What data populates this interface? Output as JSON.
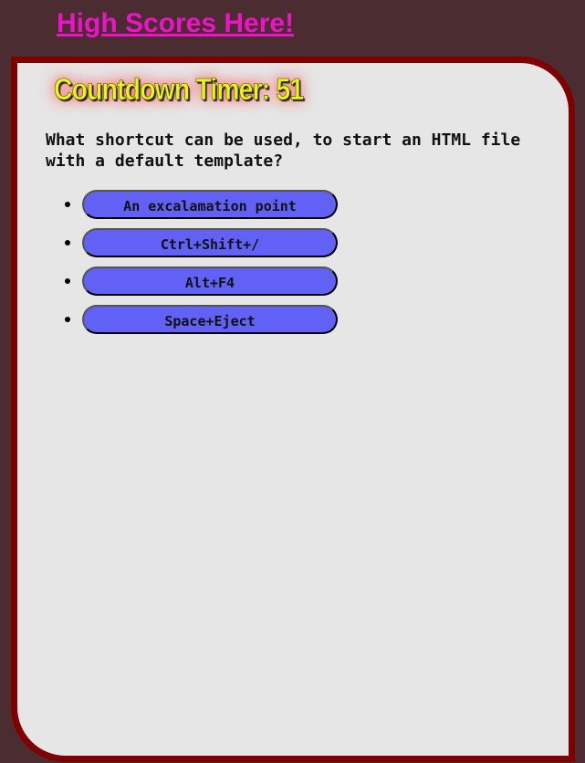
{
  "header": {
    "high_scores_link": "High Scores Here!"
  },
  "quiz": {
    "timer_text": "Countdown Timer: 51",
    "question": "What shortcut can be used, to start an HTML file with a default template?",
    "answers": [
      "An excalamation point",
      "Ctrl+Shift+/",
      "Alt+F4",
      "Space+Eject"
    ]
  },
  "colors": {
    "background": "#4b2c30",
    "card_background": "#e6e6e6",
    "card_border": "#7f0000",
    "link": "#ee12c8",
    "timer_text": "#ebf41a",
    "timer_glow": "#ff4a4a",
    "answer_button": "#6161f5"
  }
}
